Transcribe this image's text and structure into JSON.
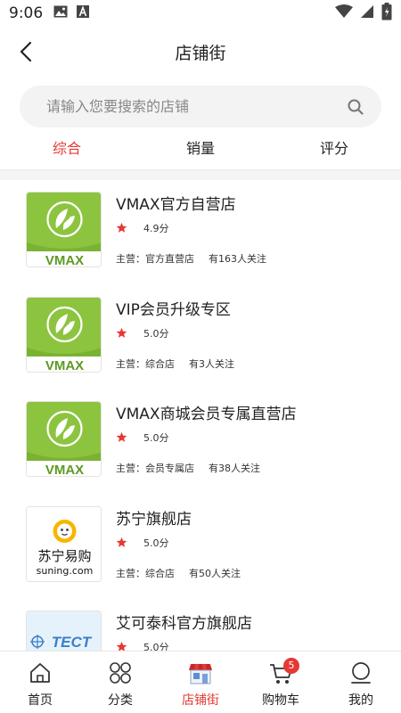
{
  "status_bar": {
    "time": "9:06"
  },
  "header": {
    "title": "店铺街"
  },
  "search": {
    "placeholder": "请输入您要搜索的店铺",
    "value": ""
  },
  "sort_tabs": [
    {
      "label": "综合",
      "active": true
    },
    {
      "label": "销量",
      "active": false
    },
    {
      "label": "评分",
      "active": false
    }
  ],
  "shops": [
    {
      "name": "VMAX官方自营店",
      "rating": "4.9分",
      "category": "主营：官方直营店",
      "followers": "有163人关注",
      "logo": "VMAX",
      "logo_icon": "vmax-leaf-logo"
    },
    {
      "name": "VIP会员升级专区",
      "rating": "5.0分",
      "category": "主营：综合店",
      "followers": "有3人关注",
      "logo": "VMAX",
      "logo_icon": "vmax-leaf-logo"
    },
    {
      "name": "VMAX商城会员专属直营店",
      "rating": "5.0分",
      "category": "主营：会员专属店",
      "followers": "有38人关注",
      "logo": "VMAX",
      "logo_icon": "vmax-leaf-logo"
    },
    {
      "name": "苏宁旗舰店",
      "rating": "5.0分",
      "category": "主营：综合店",
      "followers": "有50人关注",
      "logo": "苏宁易购 suning.com",
      "logo_icon": "suning-lion-logo"
    },
    {
      "name": "艾可泰科官方旗舰店",
      "rating": "5.0分",
      "category": "",
      "followers": "",
      "logo": "TECT",
      "logo_icon": "tect-logo"
    }
  ],
  "tab_bar": [
    {
      "label": "首页",
      "icon": "home-icon",
      "active": false
    },
    {
      "label": "分类",
      "icon": "category-icon",
      "active": false
    },
    {
      "label": "店铺街",
      "icon": "store-icon",
      "active": true
    },
    {
      "label": "购物车",
      "icon": "cart-icon",
      "active": false,
      "badge": "5"
    },
    {
      "label": "我的",
      "icon": "profile-icon",
      "active": false
    }
  ],
  "colors": {
    "accent": "#e53935",
    "vmax_green": "#8cc43f",
    "star": "#e53935"
  }
}
